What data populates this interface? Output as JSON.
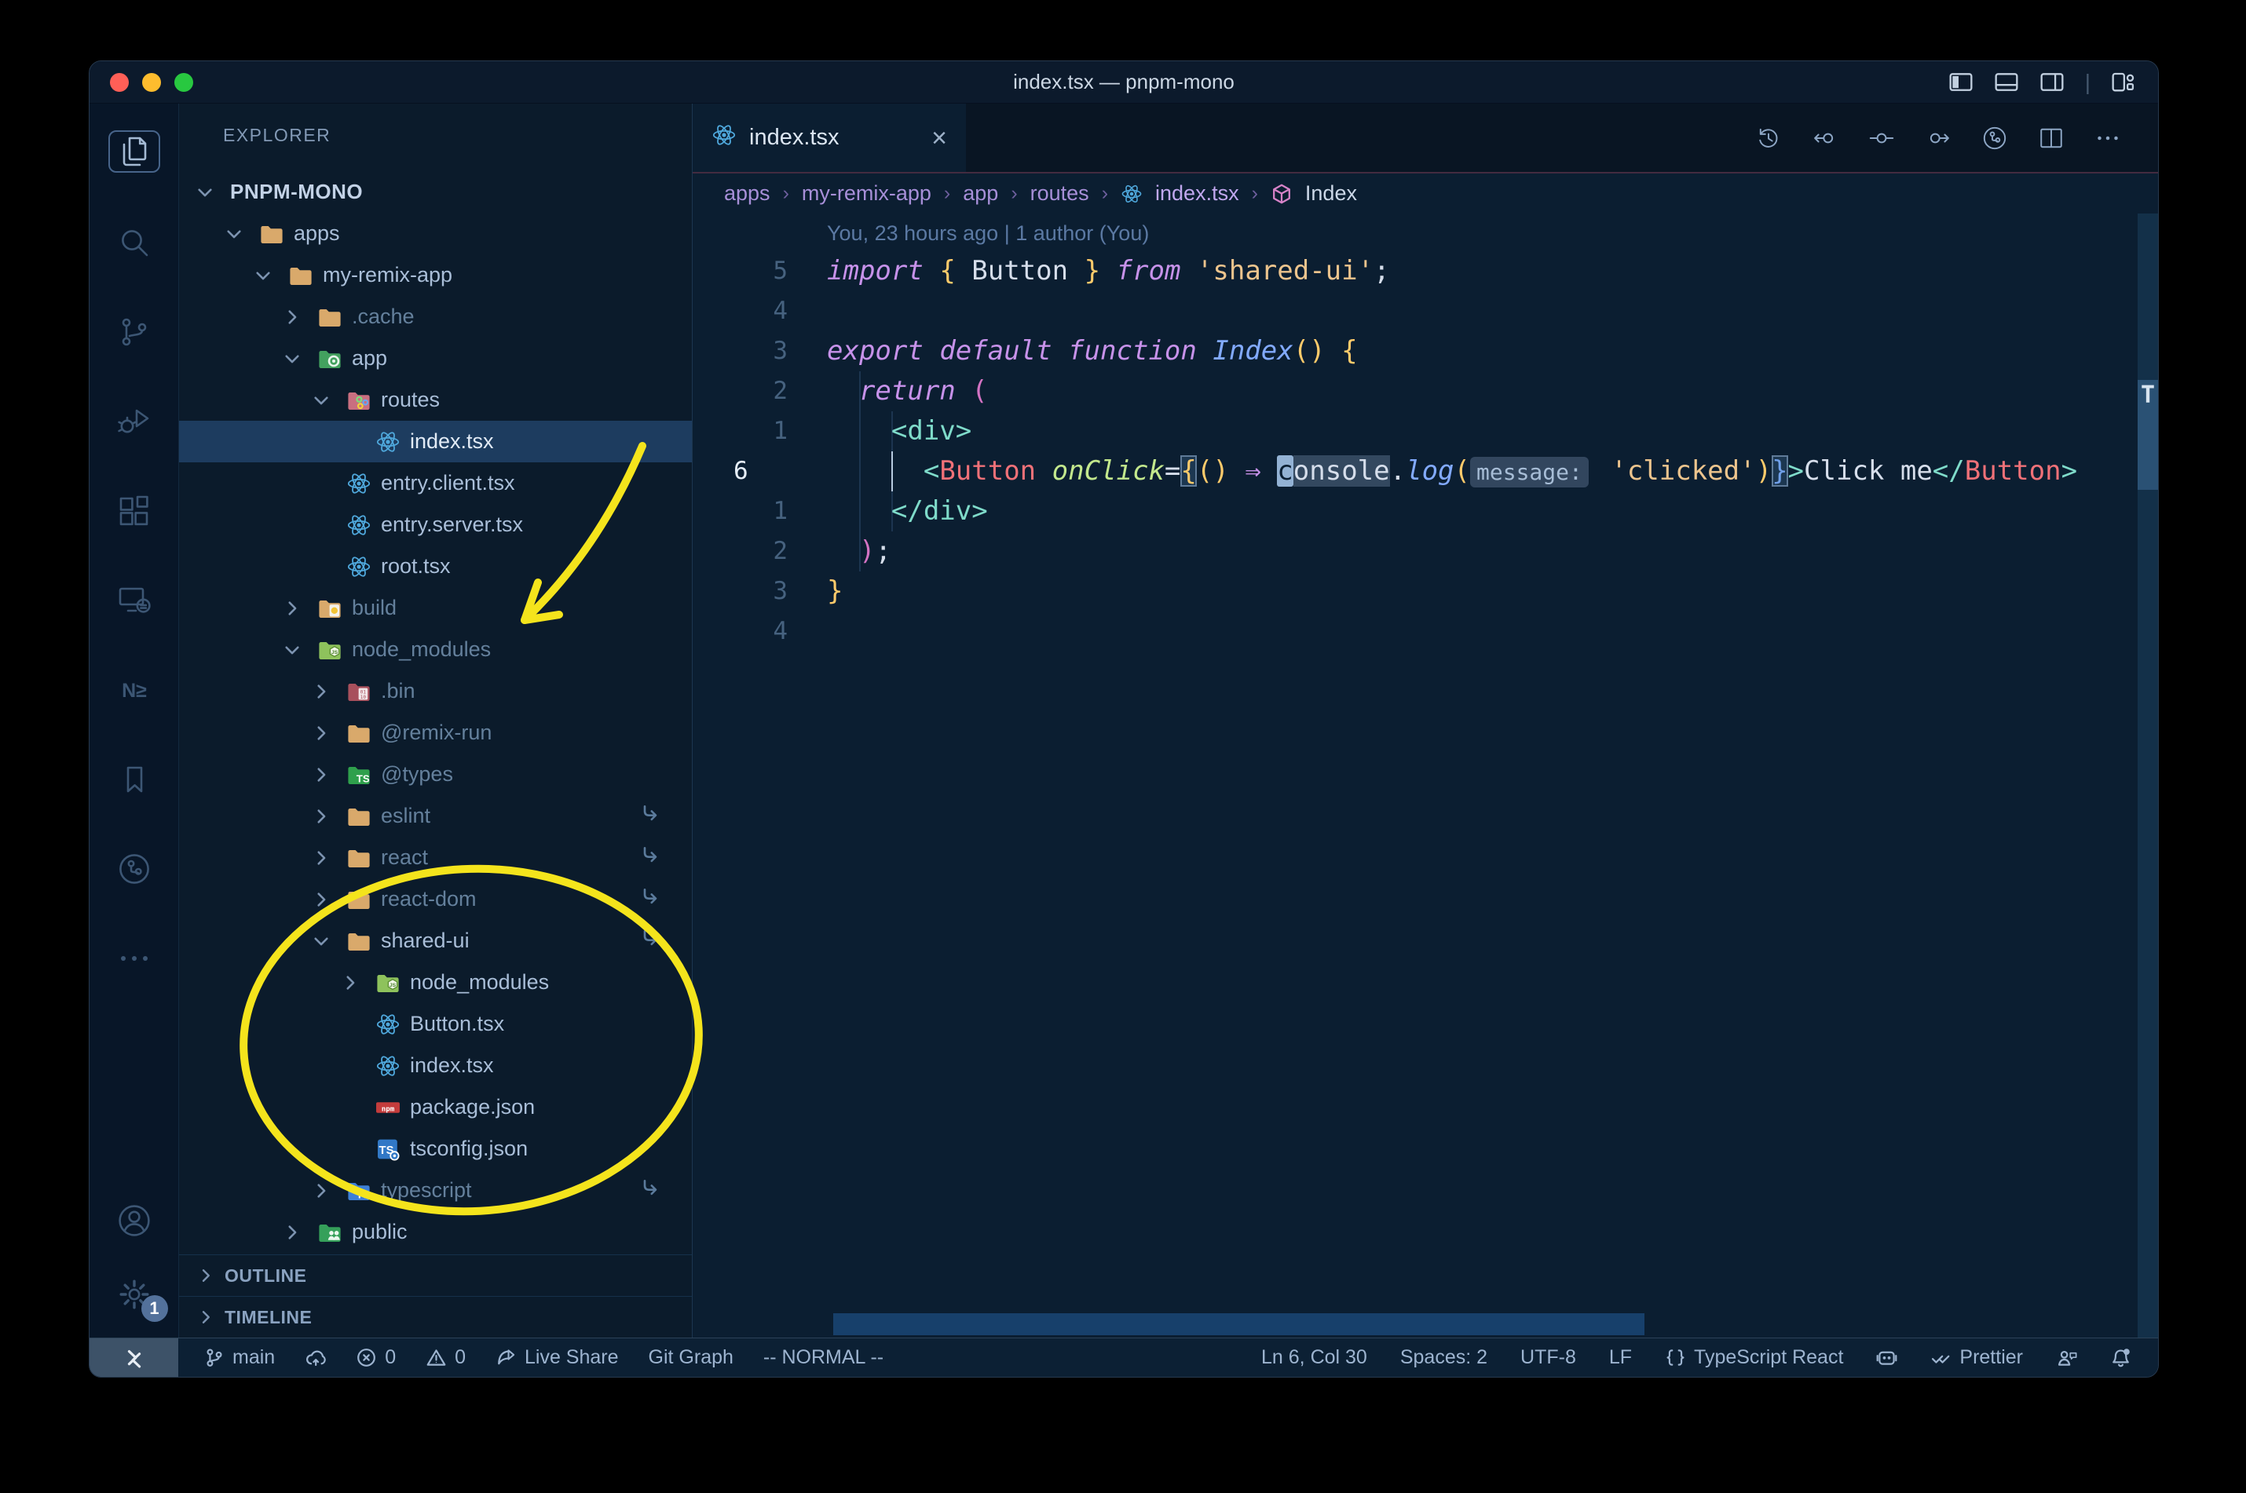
{
  "window": {
    "title": "index.tsx — pnpm-mono"
  },
  "colors": {
    "annotation_yellow": "#f4e41c",
    "editor_bg": "#0b1e31",
    "sidebar_bg": "#0b1b2b",
    "activity_bg": "#081628",
    "status_bg": "#0c2034",
    "selection_row": "#1d3c5f",
    "react_blue": "#4fa8dc",
    "keyword_purple": "#c792ea",
    "string_peach": "#ecc48d",
    "tag_coral": "#f07178",
    "tag_teal": "#7fdbca"
  },
  "titlebar": {
    "controls": [
      "layout-sidebar-left-icon",
      "layout-panel-icon",
      "layout-sidebar-right-icon",
      "|",
      "layout-customize-icon"
    ]
  },
  "activity_bar": {
    "top": [
      {
        "name": "explorer",
        "icon": "files-icon",
        "active": true
      },
      {
        "name": "search",
        "icon": "search-icon",
        "active": false
      },
      {
        "name": "source-control",
        "icon": "source-control-icon",
        "active": false
      },
      {
        "name": "run-and-debug",
        "icon": "debug-icon",
        "active": false
      },
      {
        "name": "extensions",
        "icon": "extensions-icon",
        "active": false
      },
      {
        "name": "remote-explorer",
        "icon": "remote-explorer-icon",
        "active": false
      },
      {
        "name": "nx-console",
        "icon": "nx-icon",
        "active": false
      },
      {
        "name": "bookmarks",
        "icon": "bookmarks-icon",
        "active": false
      },
      {
        "name": "gitlens",
        "icon": "gitlens-circle-icon",
        "active": false
      },
      {
        "name": "more-views",
        "icon": "more-icon",
        "active": false
      }
    ],
    "bottom": [
      {
        "name": "accounts",
        "icon": "account-icon",
        "badge": ""
      },
      {
        "name": "settings",
        "icon": "gear-icon",
        "badge": "1"
      }
    ]
  },
  "explorer": {
    "title": "EXPLORER",
    "more": "more-actions",
    "tree": [
      {
        "label": "PNPM-MONO",
        "level": 0,
        "chevron": "down",
        "icon": "",
        "root": true
      },
      {
        "label": "apps",
        "level": 1,
        "chevron": "down",
        "icon": "folder-icon"
      },
      {
        "label": "my-remix-app",
        "level": 2,
        "chevron": "down",
        "icon": "folder-icon"
      },
      {
        "label": ".cache",
        "level": 3,
        "chevron": "right",
        "icon": "folder-icon",
        "dim": true
      },
      {
        "label": "app",
        "level": 3,
        "chevron": "down",
        "icon": "folder-app-icon"
      },
      {
        "label": "routes",
        "level": 4,
        "chevron": "down",
        "icon": "folder-routes-icon"
      },
      {
        "label": "index.tsx",
        "level": 5,
        "chevron": "none",
        "icon": "react-icon",
        "selected": true
      },
      {
        "label": "entry.client.tsx",
        "level": 4,
        "chevron": "none",
        "icon": "react-icon"
      },
      {
        "label": "entry.server.tsx",
        "level": 4,
        "chevron": "none",
        "icon": "react-icon"
      },
      {
        "label": "root.tsx",
        "level": 4,
        "chevron": "none",
        "icon": "react-icon"
      },
      {
        "label": "build",
        "level": 3,
        "chevron": "right",
        "icon": "folder-build-icon",
        "dim": true
      },
      {
        "label": "node_modules",
        "level": 3,
        "chevron": "down",
        "icon": "folder-node-modules-icon",
        "dim": true
      },
      {
        "label": ".bin",
        "level": 4,
        "chevron": "right",
        "icon": "folder-bin-icon",
        "dim": true
      },
      {
        "label": "@remix-run",
        "level": 4,
        "chevron": "right",
        "icon": "folder-icon",
        "dim": true
      },
      {
        "label": "@types",
        "level": 4,
        "chevron": "right",
        "icon": "folder-types-icon",
        "dim": true
      },
      {
        "label": "eslint",
        "level": 4,
        "chevron": "right",
        "icon": "folder-icon",
        "dim": true,
        "symlink": true
      },
      {
        "label": "react",
        "level": 4,
        "chevron": "right",
        "icon": "folder-icon",
        "dim": true,
        "symlink": true
      },
      {
        "label": "react-dom",
        "level": 4,
        "chevron": "right",
        "icon": "folder-icon",
        "dim": true,
        "symlink": true
      },
      {
        "label": "shared-ui",
        "level": 4,
        "chevron": "down",
        "icon": "folder-icon",
        "symlink": true
      },
      {
        "label": "node_modules",
        "level": 5,
        "chevron": "right",
        "icon": "folder-node-modules-icon"
      },
      {
        "label": "Button.tsx",
        "level": 5,
        "chevron": "none",
        "icon": "react-icon"
      },
      {
        "label": "index.tsx",
        "level": 5,
        "chevron": "none",
        "icon": "react-icon"
      },
      {
        "label": "package.json",
        "level": 5,
        "chevron": "none",
        "icon": "npm-icon"
      },
      {
        "label": "tsconfig.json",
        "level": 5,
        "chevron": "none",
        "icon": "tsconfig-icon"
      },
      {
        "label": "typescript",
        "level": 4,
        "chevron": "right",
        "icon": "folder-typescript-icon",
        "dim": true,
        "symlink": true
      },
      {
        "label": "public",
        "level": 3,
        "chevron": "right",
        "icon": "folder-public-icon"
      }
    ],
    "sections": [
      "OUTLINE",
      "TIMELINE"
    ]
  },
  "tab": {
    "label": "index.tsx",
    "icon": "react-icon",
    "close": "×"
  },
  "editor_toolbar": [
    "history-icon",
    "prev-change-icon",
    "compare-icon",
    "next-change-icon",
    "gitlens-icon",
    "split-editor-icon",
    "more-icon"
  ],
  "breadcrumbs": [
    {
      "label": "apps",
      "cls": "crumb"
    },
    {
      "label": "my-remix-app",
      "cls": "crumb"
    },
    {
      "label": "app",
      "cls": "crumb"
    },
    {
      "label": "routes",
      "cls": "crumb"
    },
    {
      "icon": "react-icon",
      "label": "index.tsx",
      "cls": "crumb hl"
    },
    {
      "icon": "symbol-cube-icon",
      "label": "Index",
      "cls": "crumb sym"
    }
  ],
  "editor": {
    "blame": "You, 23 hours ago | 1 author (You)",
    "minimap_letter": "T",
    "lines": [
      {
        "num": "5",
        "tokens": [
          [
            "import",
            "kw"
          ],
          [
            " ",
            "fg"
          ],
          [
            "{",
            "y"
          ],
          [
            " Button ",
            "fg"
          ],
          [
            "}",
            "y"
          ],
          [
            " ",
            "fg"
          ],
          [
            "from",
            "kw"
          ],
          [
            " ",
            "fg"
          ],
          [
            "'shared-ui'",
            "str"
          ],
          [
            ";",
            "fg"
          ]
        ]
      },
      {
        "num": "4",
        "tokens": []
      },
      {
        "num": "3",
        "tokens": [
          [
            "export",
            "kw"
          ],
          [
            " ",
            "fg"
          ],
          [
            "default",
            "kw"
          ],
          [
            " ",
            "fg"
          ],
          [
            "function",
            "kw"
          ],
          [
            " ",
            "fg"
          ],
          [
            "Index",
            "fn"
          ],
          [
            "()",
            "y"
          ],
          [
            " ",
            "fg"
          ],
          [
            "{",
            "y"
          ]
        ]
      },
      {
        "num": "2",
        "tokens": [
          [
            "  ",
            "fg"
          ],
          [
            "return",
            "kw"
          ],
          [
            " ",
            "fg"
          ],
          [
            "(",
            "pink"
          ]
        ]
      },
      {
        "num": "1",
        "tokens": [
          [
            "    ",
            "fg"
          ],
          [
            "<div>",
            "tagb"
          ]
        ]
      },
      {
        "num": "6",
        "current": true,
        "tokens": [
          [
            "      ",
            "fg"
          ],
          [
            "<",
            "tagb"
          ],
          [
            "Button",
            "tag"
          ],
          [
            " ",
            "fg"
          ],
          [
            "onClick",
            "attr"
          ],
          [
            "=",
            "fg"
          ],
          [
            "{",
            "boxy"
          ],
          [
            "()",
            "y"
          ],
          [
            " ",
            "fg"
          ],
          [
            "⇒",
            "arrow"
          ],
          [
            " ",
            "fg"
          ],
          [
            "c",
            "cur"
          ],
          [
            "onsole",
            "whl"
          ],
          [
            ".",
            "fg"
          ],
          [
            "log",
            "fn"
          ],
          [
            "(",
            "y"
          ],
          [
            "message:",
            "inlay"
          ],
          [
            " ",
            "fg"
          ],
          [
            "'clicked'",
            "str"
          ],
          [
            ")",
            "y"
          ],
          [
            "}",
            "boxb"
          ],
          [
            ">",
            "tagb"
          ],
          [
            "Click me",
            "fg"
          ],
          [
            "</",
            "tagb"
          ],
          [
            "Button",
            "tag"
          ],
          [
            ">",
            "tagb"
          ]
        ]
      },
      {
        "num": "1",
        "tokens": [
          [
            "    ",
            "fg"
          ],
          [
            "</div>",
            "tagb"
          ]
        ]
      },
      {
        "num": "2",
        "tokens": [
          [
            "  ",
            "fg"
          ],
          [
            ")",
            "pink"
          ],
          [
            ";",
            "fg"
          ]
        ]
      },
      {
        "num": "3",
        "tokens": [
          [
            "}",
            "y"
          ]
        ]
      },
      {
        "num": "4",
        "tokens": []
      }
    ]
  },
  "statusbar": {
    "left": [
      {
        "icon": "git-branch-icon",
        "label": "main"
      },
      {
        "icon": "cloud-upload-icon",
        "label": ""
      },
      {
        "icon": "error-icon",
        "label": "0"
      },
      {
        "icon": "warning-icon",
        "label": "0"
      },
      {
        "icon": "live-share-icon",
        "label": "Live Share"
      },
      {
        "icon": "",
        "label": "Git Graph"
      },
      {
        "icon": "",
        "label": "-- NORMAL --"
      }
    ],
    "right": [
      {
        "icon": "",
        "label": "Ln 6, Col 30"
      },
      {
        "icon": "",
        "label": "Spaces: 2"
      },
      {
        "icon": "",
        "label": "UTF-8"
      },
      {
        "icon": "",
        "label": "LF"
      },
      {
        "icon": "braces-icon",
        "label": "TypeScript React"
      },
      {
        "icon": "robot-icon",
        "label": ""
      },
      {
        "icon": "double-check-icon",
        "label": "Prettier"
      },
      {
        "icon": "person-feedback-icon",
        "label": ""
      },
      {
        "icon": "bell-icon",
        "label": ""
      }
    ]
  }
}
